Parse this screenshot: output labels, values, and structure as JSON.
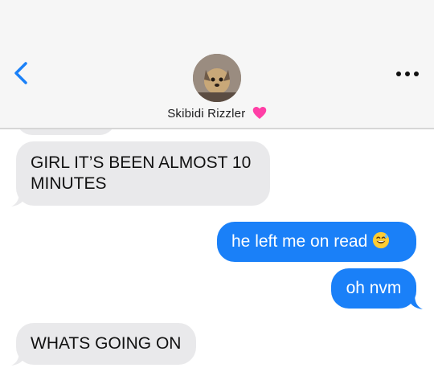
{
  "header": {
    "contact_name": "Skibidi Rizzler",
    "back_icon": "chevron-left-icon",
    "more_icon": "ellipsis-icon",
    "name_emoji": "pink-heart-emoji",
    "accent": "#1a80f8"
  },
  "messages": [
    {
      "direction": "incoming",
      "text": "GIRL IT’S BEEN ALMOST 10 MINUTES"
    },
    {
      "direction": "outgoing",
      "text": "he left me on read",
      "emoji": "grinning-sweat-emoji"
    },
    {
      "direction": "outgoing",
      "text": "oh nvm"
    },
    {
      "direction": "incoming",
      "text": "WHATS GOING ON"
    }
  ]
}
